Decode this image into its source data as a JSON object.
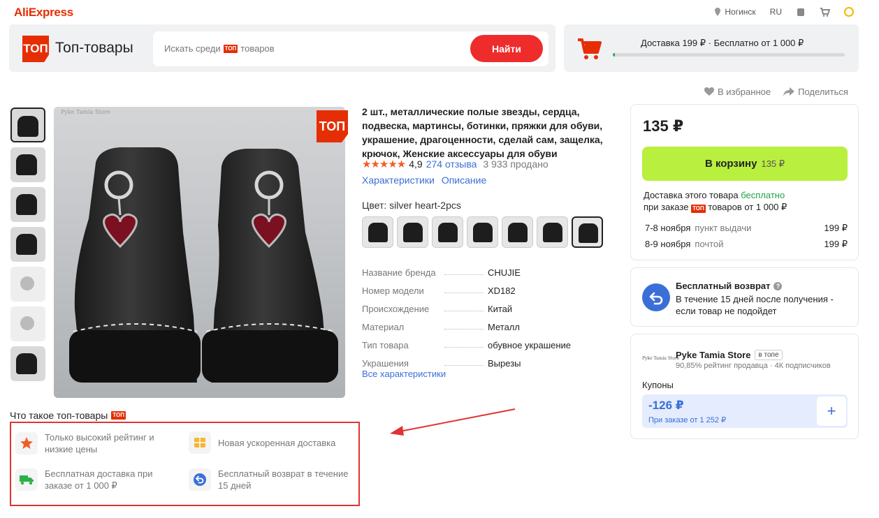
{
  "topbar": {
    "logo": "AliExpress",
    "location": "Ногинск",
    "language": "RU"
  },
  "header": {
    "badge": "ТОП",
    "title": "Топ-товары",
    "search_placeholder_before": "Искать среди",
    "search_placeholder_badge": "ТОП",
    "search_placeholder_after": "товаров",
    "search_button": "Найти",
    "delivery_text": "Доставка 199 ₽  ·  Бесплатно от 1 000 ₽",
    "delivery_progress": 0.01
  },
  "gallery": {
    "watermark": "Pyke Tamia Store",
    "badge": "ТОП",
    "thumb_count": 7,
    "selected_thumb": 0
  },
  "product": {
    "title": "2 шт., металлические полые звезды, сердца, подвеска, мартинсы, ботинки, пряжки для обуви, украшение, драгоценности, сделай сам, защелка, крючок, Женские аксессуары для обуви",
    "stars": "★★★★★",
    "rating": "4,9",
    "reviews": "274 отзыва",
    "sold": "3 933 продано",
    "tab_specs": "Характеристики",
    "tab_description": "Описание",
    "color_label": "Цвет: silver heart-2pcs",
    "selected_swatch": 6,
    "specs": [
      {
        "key": "Название бренда",
        "value": "CHUJIE"
      },
      {
        "key": "Номер модели",
        "value": "XD182"
      },
      {
        "key": "Происхождение",
        "value": "Китай"
      },
      {
        "key": "Материал",
        "value": "Металл"
      },
      {
        "key": "Тип товара",
        "value": "обувное украшение"
      },
      {
        "key": "Украшения",
        "value": "Вырезы"
      }
    ],
    "all_specs_link": "Все характеристики"
  },
  "actions": {
    "favorite": "В избранное",
    "share": "Поделиться"
  },
  "buy": {
    "price": "135 ₽",
    "cart_button": "В корзину",
    "cart_button_price": "135 ₽",
    "free_delivery_prefix": "Доставка этого товара",
    "free_delivery_word": "бесплатно",
    "free_delivery_line2_prefix": "при заказе",
    "free_delivery_badge": "ТОП",
    "free_delivery_line2_suffix": "товаров от 1 000 ₽",
    "options": [
      {
        "date": "7-8 ноября",
        "method": "пункт выдачи",
        "price": "199 ₽"
      },
      {
        "date": "8-9 ноября",
        "method": "почтой",
        "price": "199 ₽"
      }
    ]
  },
  "returns": {
    "title": "Бесплатный возврат",
    "info": "?",
    "text": "В течение 15 дней после получения - если товар не подойдет"
  },
  "store": {
    "logo_text": "Pyke Tamia Store",
    "name": "Pyke Tamia Store",
    "tag": "в топе",
    "stats": "90,85% рейтинг продавца  ·  4К подписчиков",
    "coupons_label": "Купоны",
    "coupon_amount": "-126 ₽",
    "coupon_condition": "При заказе от 1 252 ₽",
    "coupon_add": "+"
  },
  "what_is_top": {
    "title": "Что такое топ-товары",
    "badge": "ТОП",
    "features": [
      {
        "icon": "star-icon",
        "text": "Только высокий рейтинг и низкие цены"
      },
      {
        "icon": "box-icon",
        "text": "Новая ускоренная доставка"
      },
      {
        "icon": "truck-icon",
        "text": "Бесплатная доставка при заказе от 1 000 ₽"
      },
      {
        "icon": "return-icon",
        "text": "Бесплатный возврат в течение 15 дней"
      }
    ]
  },
  "colors": {
    "brand_red": "#e62e04",
    "search_red": "#ee2c2c",
    "cart_green": "#b9ef3e",
    "link_blue": "#3a6fd8",
    "free_green": "#1fa34a",
    "highlight_red": "#e03333"
  }
}
